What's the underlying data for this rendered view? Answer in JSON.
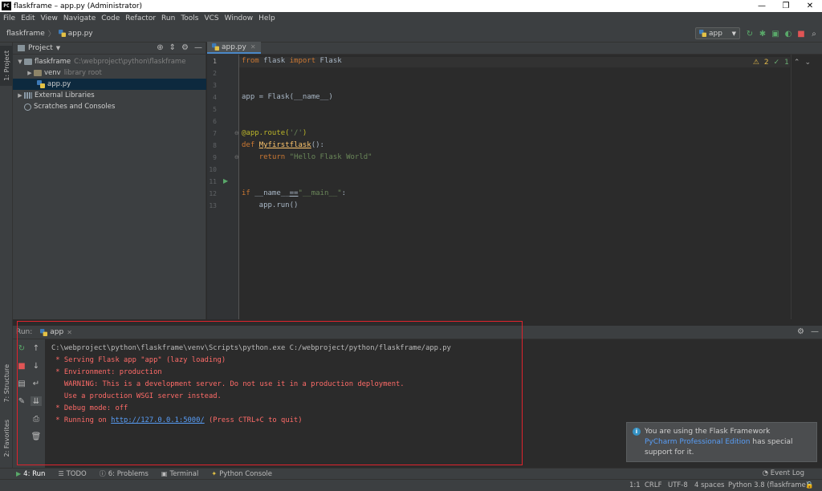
{
  "window": {
    "title": "flaskframe – app.py (Administrator)",
    "app_icon_text": "PC",
    "minimize": "—",
    "maximize": "❐",
    "close": "✕"
  },
  "menu": {
    "items": [
      "File",
      "Edit",
      "View",
      "Navigate",
      "Code",
      "Refactor",
      "Run",
      "Tools",
      "VCS",
      "Window",
      "Help"
    ]
  },
  "navbar": {
    "project": "flaskframe",
    "file": "app.py",
    "run_config": "app"
  },
  "project_panel": {
    "title": "Project",
    "tree": [
      {
        "label": "flaskframe",
        "hint": "C:\\webproject\\python\\flaskframe"
      },
      {
        "label": "venv",
        "hint": "library root"
      },
      {
        "label": "app.py",
        "hint": ""
      },
      {
        "label": "External Libraries",
        "hint": ""
      },
      {
        "label": "Scratches and Consoles",
        "hint": ""
      }
    ]
  },
  "left_strip": {
    "project_tab": "1: Project",
    "structure_tab": "7: Structure",
    "favorites_tab": "2: Favorites"
  },
  "editor": {
    "tab": "app.py",
    "line_numbers": [
      "1",
      "2",
      "3",
      "4",
      "5",
      "6",
      "7",
      "8",
      "9",
      "10",
      "11",
      "12",
      "13"
    ],
    "inspection": {
      "warnings": "2",
      "weak": "1"
    }
  },
  "run_panel": {
    "label": "Run:",
    "tab": "app",
    "console": [
      "C:\\webproject\\python\\flaskframe\\venv\\Scripts\\python.exe C:/webproject/python/flaskframe/app.py",
      " * Serving Flask app \"app\" (lazy loading)",
      " * Environment: production",
      "   WARNING: This is a development server. Do not use it in a production deployment.",
      "   Use a production WSGI server instead.",
      " * Debug mode: off"
    ],
    "running_prefix": " * Running on ",
    "running_url": "http://127.0.0.1:5000/",
    "running_suffix": " (Press CTRL+C to quit)"
  },
  "notification": {
    "title": "You are using the Flask Framework",
    "link": "PyCharm Professional Edition",
    "body_suffix": " has special",
    "body_line2": "support for it."
  },
  "bottom_bar": {
    "run": "4: Run",
    "todo": "TODO",
    "problems": "6: Problems",
    "terminal": "Terminal",
    "python_console": "Python Console",
    "event_log": "Event Log"
  },
  "status_bar": {
    "position": "1:1",
    "line_sep": "CRLF",
    "encoding": "UTF-8",
    "indent": "4 spaces",
    "interpreter": "Python 3.8 (flaskframe)"
  },
  "colors": {
    "accent": "#4a88c7",
    "highlight_box": "#e0232d",
    "error_text": "#ff6b68",
    "link": "#589df6"
  }
}
